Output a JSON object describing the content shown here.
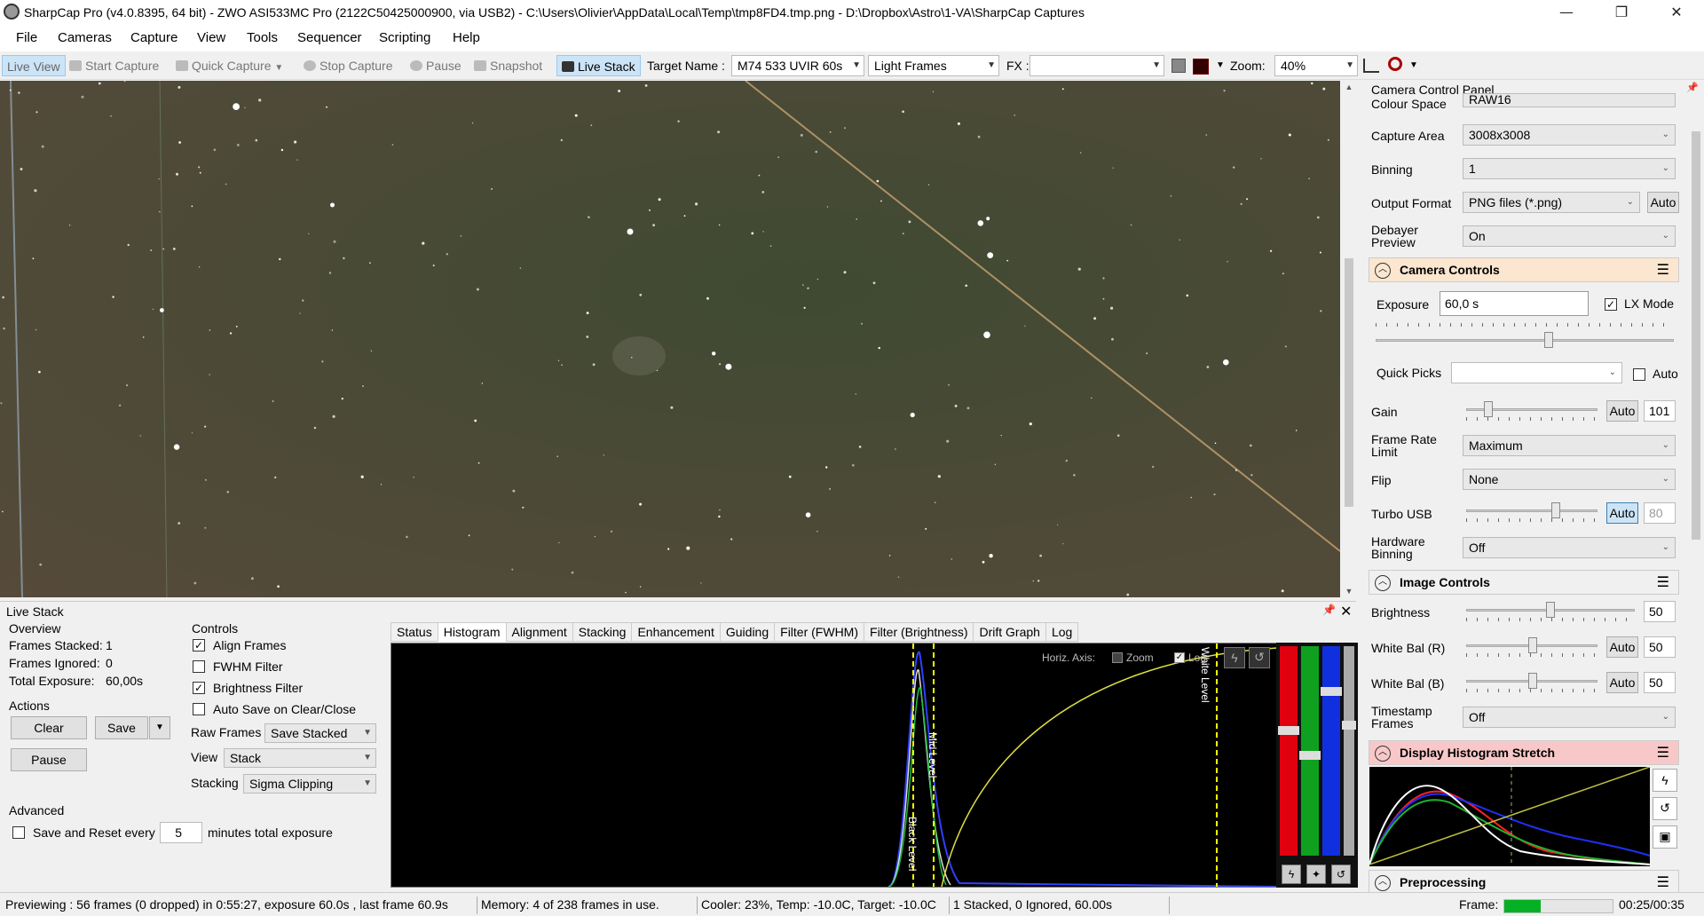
{
  "window": {
    "title": "SharpCap Pro (v4.0.8395, 64 bit) - ZWO ASI533MC Pro (2122C50425000900, via USB2) - C:\\Users\\Olivier\\AppData\\Local\\Temp\\tmp8FD4.tmp.png - D:\\Dropbox\\Astro\\1-VA\\SharpCap Captures",
    "minimize": "—",
    "restore": "❐",
    "close": "✕"
  },
  "menu": [
    "File",
    "Cameras",
    "Capture",
    "View",
    "Tools",
    "Sequencer",
    "Scripting",
    "Help"
  ],
  "toolbar": {
    "live_view": "Live View",
    "start_capture": "Start Capture",
    "quick_capture": "Quick Capture",
    "stop_capture": "Stop Capture",
    "pause": "Pause",
    "snapshot": "Snapshot",
    "live_stack": "Live Stack",
    "target_name_label": "Target Name :",
    "target_name_value": "M74 533 UVIR 60s",
    "frame_type": "Light Frames",
    "fx_label": "FX :",
    "fx_value": "",
    "zoom_label": "Zoom:",
    "zoom_value": "40%"
  },
  "live_stack": {
    "title": "Live Stack",
    "overview_label": "Overview",
    "frames_stacked_label": "Frames Stacked:",
    "frames_stacked": "1",
    "frames_ignored_label": "Frames Ignored:",
    "frames_ignored": "0",
    "total_exposure_label": "Total Exposure:",
    "total_exposure": "60,00s",
    "actions_label": "Actions",
    "clear": "Clear",
    "save": "Save",
    "pause": "Pause",
    "advanced_label": "Advanced",
    "save_reset_label": "Save and Reset every",
    "save_reset_value": "5",
    "save_reset_suffix": "minutes total exposure",
    "controls_label": "Controls",
    "align_frames": "Align Frames",
    "fwhm_filter": "FWHM Filter",
    "brightness_filter": "Brightness Filter",
    "auto_save": "Auto Save on Clear/Close",
    "raw_frames_label": "Raw Frames",
    "raw_frames_value": "Save Stacked",
    "view_label": "View",
    "view_value": "Stack",
    "stacking_label": "Stacking",
    "stacking_value": "Sigma Clipping",
    "tabs": [
      "Status",
      "Histogram",
      "Alignment",
      "Stacking",
      "Enhancement",
      "Guiding",
      "Filter (FWHM)",
      "Filter (Brightness)",
      "Drift Graph",
      "Log"
    ],
    "horiz_axis_label": "Horiz. Axis:",
    "zoom_check_label": "Zoom",
    "log_check_label": "Log",
    "black_level_label": "Black Level",
    "mid_level_label": "Mid Level",
    "white_level_label": "White Level"
  },
  "right_panel": {
    "title": "Camera Control Panel",
    "colour_space_label": "Colour Space",
    "colour_space": "RAW16",
    "capture_area_label": "Capture Area",
    "capture_area": "3008x3008",
    "binning_label": "Binning",
    "binning": "1",
    "output_format_label": "Output Format",
    "output_format": "PNG files (*.png)",
    "auto": "Auto",
    "debayer_label_1": "Debayer",
    "debayer_label_2": "Preview",
    "debayer": "On",
    "camera_controls": "Camera Controls",
    "exposure_label": "Exposure",
    "exposure": "60,0 s",
    "lx_mode": "LX Mode",
    "quick_picks_label": "Quick Picks",
    "gain_label": "Gain",
    "gain": "101",
    "frame_rate_label_1": "Frame Rate",
    "frame_rate_label_2": "Limit",
    "frame_rate": "Maximum",
    "flip_label": "Flip",
    "flip": "None",
    "turbo_usb_label": "Turbo USB",
    "turbo_usb": "80",
    "hw_binning_label_1": "Hardware",
    "hw_binning_label_2": "Binning",
    "hw_binning": "Off",
    "image_controls": "Image Controls",
    "brightness_label": "Brightness",
    "brightness": "50",
    "wb_r_label": "White Bal (R)",
    "wb_r": "50",
    "wb_b_label": "White Bal (B)",
    "wb_b": "50",
    "timestamp_label_1": "Timestamp",
    "timestamp_label_2": "Frames",
    "timestamp": "Off",
    "display_histogram": "Display Histogram Stretch",
    "preprocessing": "Preprocessing"
  },
  "status": {
    "preview": "Previewing : 56 frames (0 dropped) in 0:55:27, exposure 60.0s , last frame 60.9s",
    "memory": "Memory: 4 of 238 frames in use.",
    "cooler": "Cooler: 23%, Temp: -10.0C, Target: -10.0C",
    "stack": "1 Stacked, 0 Ignored, 60.00s",
    "frame_label": "Frame:",
    "frame_progress": 0.34,
    "time": "00:25/00:35"
  },
  "colors": {
    "accent": "#cce4f7",
    "camera_controls_bg": "#fbe6d0",
    "histogram_stretch_bg": "#f8c8c8",
    "progress": "#06b025"
  }
}
